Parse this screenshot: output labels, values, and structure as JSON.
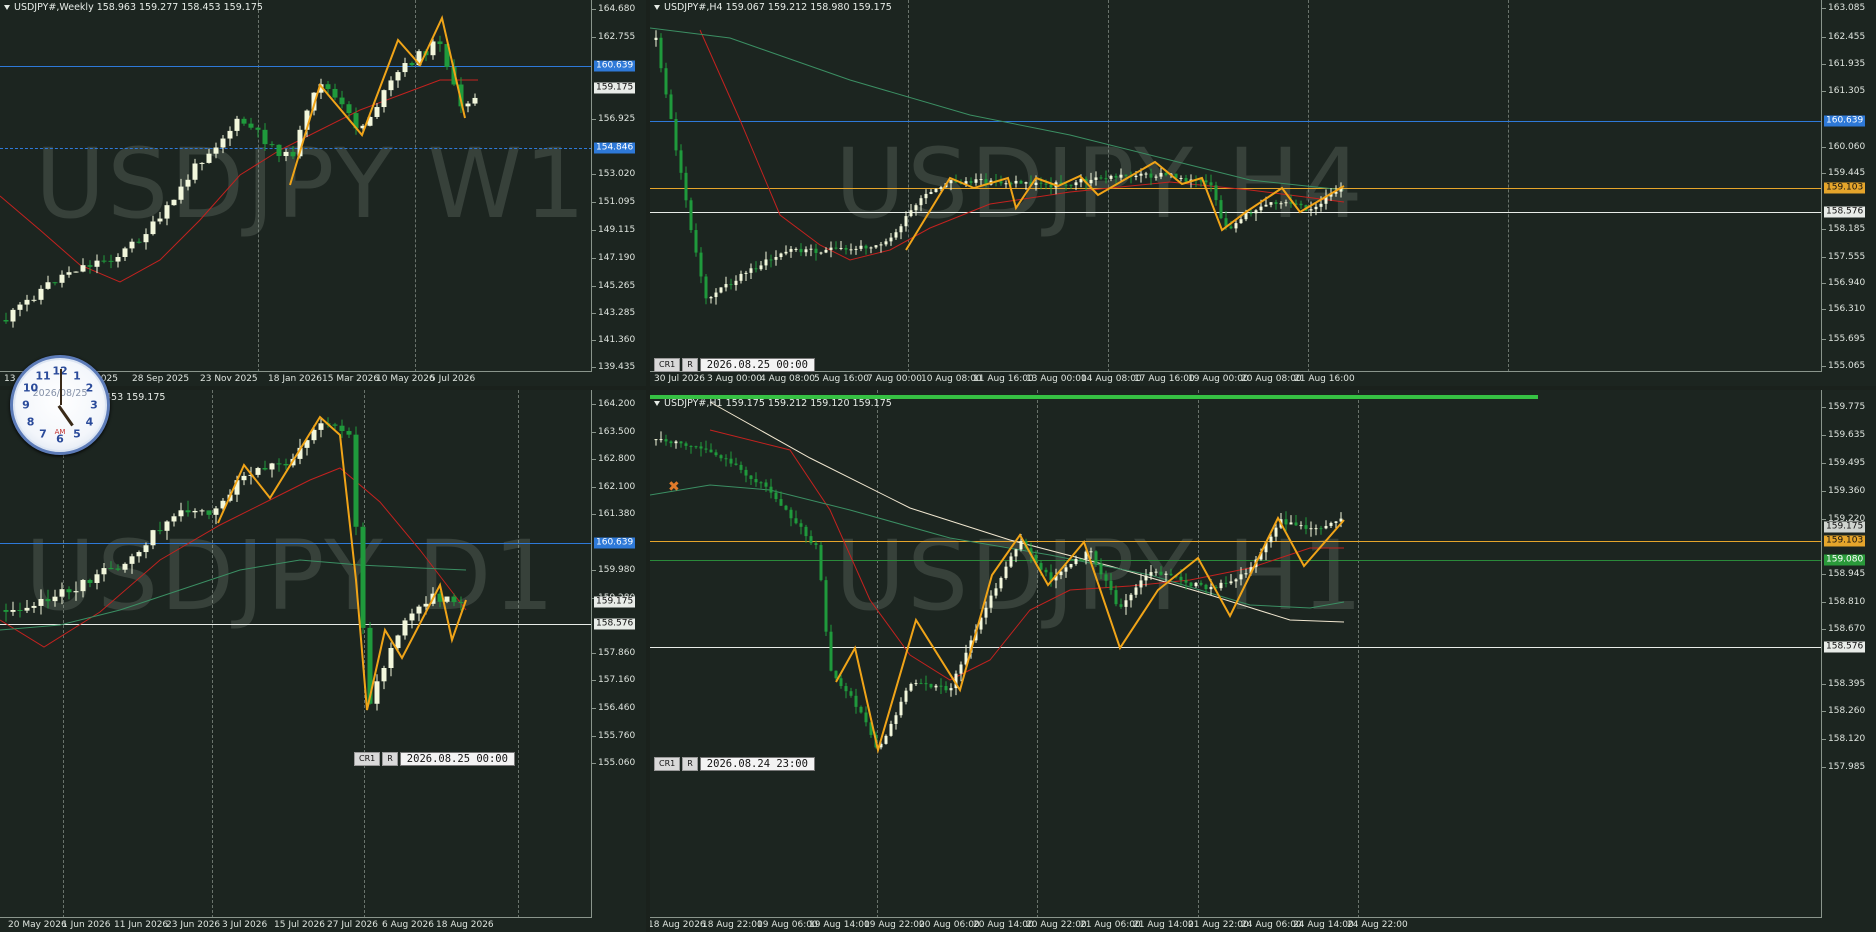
{
  "panes": [
    {
      "id": "w1",
      "header": "USDJPY#,Weekly  158.963 159.277 158.453 159.175",
      "watermark": "USDJPY W1",
      "y_labels": [
        "164.680",
        "162.755",
        "160.639",
        "159.175",
        "156.925",
        "154.846",
        "153.020",
        "151.095",
        "149.115",
        "147.190",
        "145.265",
        "143.285",
        "141.360",
        "139.435"
      ],
      "x_labels": [
        "13",
        "3 Aug 2025",
        "28 Sep 2025",
        "23 Nov 2025",
        "18 Jan 2026",
        "15 Mar 2026",
        "10 May 2026",
        "5 Jul 2026"
      ],
      "price_tags": {
        "blue_solid": "160.639",
        "current": "159.175",
        "blue_dashed": "154.846"
      }
    },
    {
      "id": "h4",
      "header": "USDJPY#,H4  159.067 159.212 158.980 159.175",
      "watermark": "USDJPY H4",
      "y_labels": [
        "163.085",
        "162.455",
        "161.935",
        "161.305",
        "160.639",
        "160.060",
        "159.445",
        "159.103",
        "158.576",
        "158.185",
        "157.555",
        "156.940",
        "156.310",
        "155.695",
        "155.065"
      ],
      "x_labels": [
        "30 Jul 2026",
        "3 Aug 00:00",
        "4 Aug 08:00",
        "5 Aug 16:00",
        "7 Aug 00:00",
        "10 Aug 08:00",
        "11 Aug 16:00",
        "13 Aug 00:00",
        "14 Aug 08:00",
        "17 Aug 16:00",
        "19 Aug 00:00",
        "20 Aug 08:00",
        "21 Aug 16:00"
      ],
      "price_tags": {
        "blue": "160.639",
        "orange": "159.103",
        "white": "158.576"
      },
      "timebar": {
        "tab": "CR1",
        "btn": "R",
        "value": "2026.08.25 00:00"
      }
    },
    {
      "id": "d1",
      "header": "453 159.175",
      "watermark": "USDJPY D1",
      "y_labels": [
        "164.200",
        "163.500",
        "162.800",
        "162.100",
        "161.380",
        "160.639",
        "159.980",
        "159.280",
        "159.175",
        "158.576",
        "157.860",
        "157.160",
        "156.460",
        "155.760",
        "155.060"
      ],
      "x_labels": [
        "20 May 2026",
        "1 Jun 2026",
        "11 Jun 2026",
        "23 Jun 2026",
        "3 Jul 2026",
        "15 Jul 2026",
        "27 Jul 2026",
        "6 Aug 2026",
        "18 Aug 2026"
      ],
      "price_tags": {
        "blue": "160.639",
        "current": "159.175",
        "white": "158.576"
      },
      "timebar": {
        "tab": "CR1",
        "btn": "R",
        "value": "2026.08.25 00:00"
      }
    },
    {
      "id": "h1",
      "header": "USDJPY#,H1  159.175 159.212 159.120 159.175",
      "watermark": "USDJPY H1",
      "y_labels": [
        "159.775",
        "159.635",
        "159.495",
        "159.360",
        "159.220",
        "159.175",
        "159.103",
        "159.080",
        "158.945",
        "158.810",
        "158.670",
        "158.576",
        "158.395",
        "158.260",
        "158.120",
        "157.985"
      ],
      "x_labels": [
        "18 Aug 2026",
        "18 Aug 22:00",
        "19 Aug 06:00",
        "19 Aug 14:00",
        "19 Aug 22:00",
        "20 Aug 06:00",
        "20 Aug 14:00",
        "20 Aug 22:00",
        "21 Aug 06:00",
        "21 Aug 14:00",
        "21 Aug 22:00",
        "24 Aug 06:00",
        "24 Aug 14:00",
        "24 Aug 22:00"
      ],
      "price_tags": {
        "white_grey": "159.175",
        "orange": "159.103",
        "green": "159.080",
        "white": "158.576"
      },
      "timebar": {
        "tab": "CR1",
        "btn": "R",
        "value": "2026.08.24 23:00"
      }
    }
  ],
  "clock": {
    "date": "2026/08/25",
    "ampm": "AM",
    "numbers": [
      "12",
      "1",
      "2",
      "3",
      "4",
      "5",
      "6",
      "7",
      "8",
      "9",
      "10",
      "11"
    ]
  },
  "colors": {
    "bg": "#1c2520",
    "bull": "#f2f7dc",
    "bear": "#1f9a3c",
    "zigzag": "#f0a418",
    "ma_red": "#c3221f",
    "ma_green": "#3b8f63",
    "ma_white": "#f1e7d0",
    "level_blue": "#2e79d8",
    "level_orange": "#e5a52b",
    "level_white": "#e8ece8"
  }
}
